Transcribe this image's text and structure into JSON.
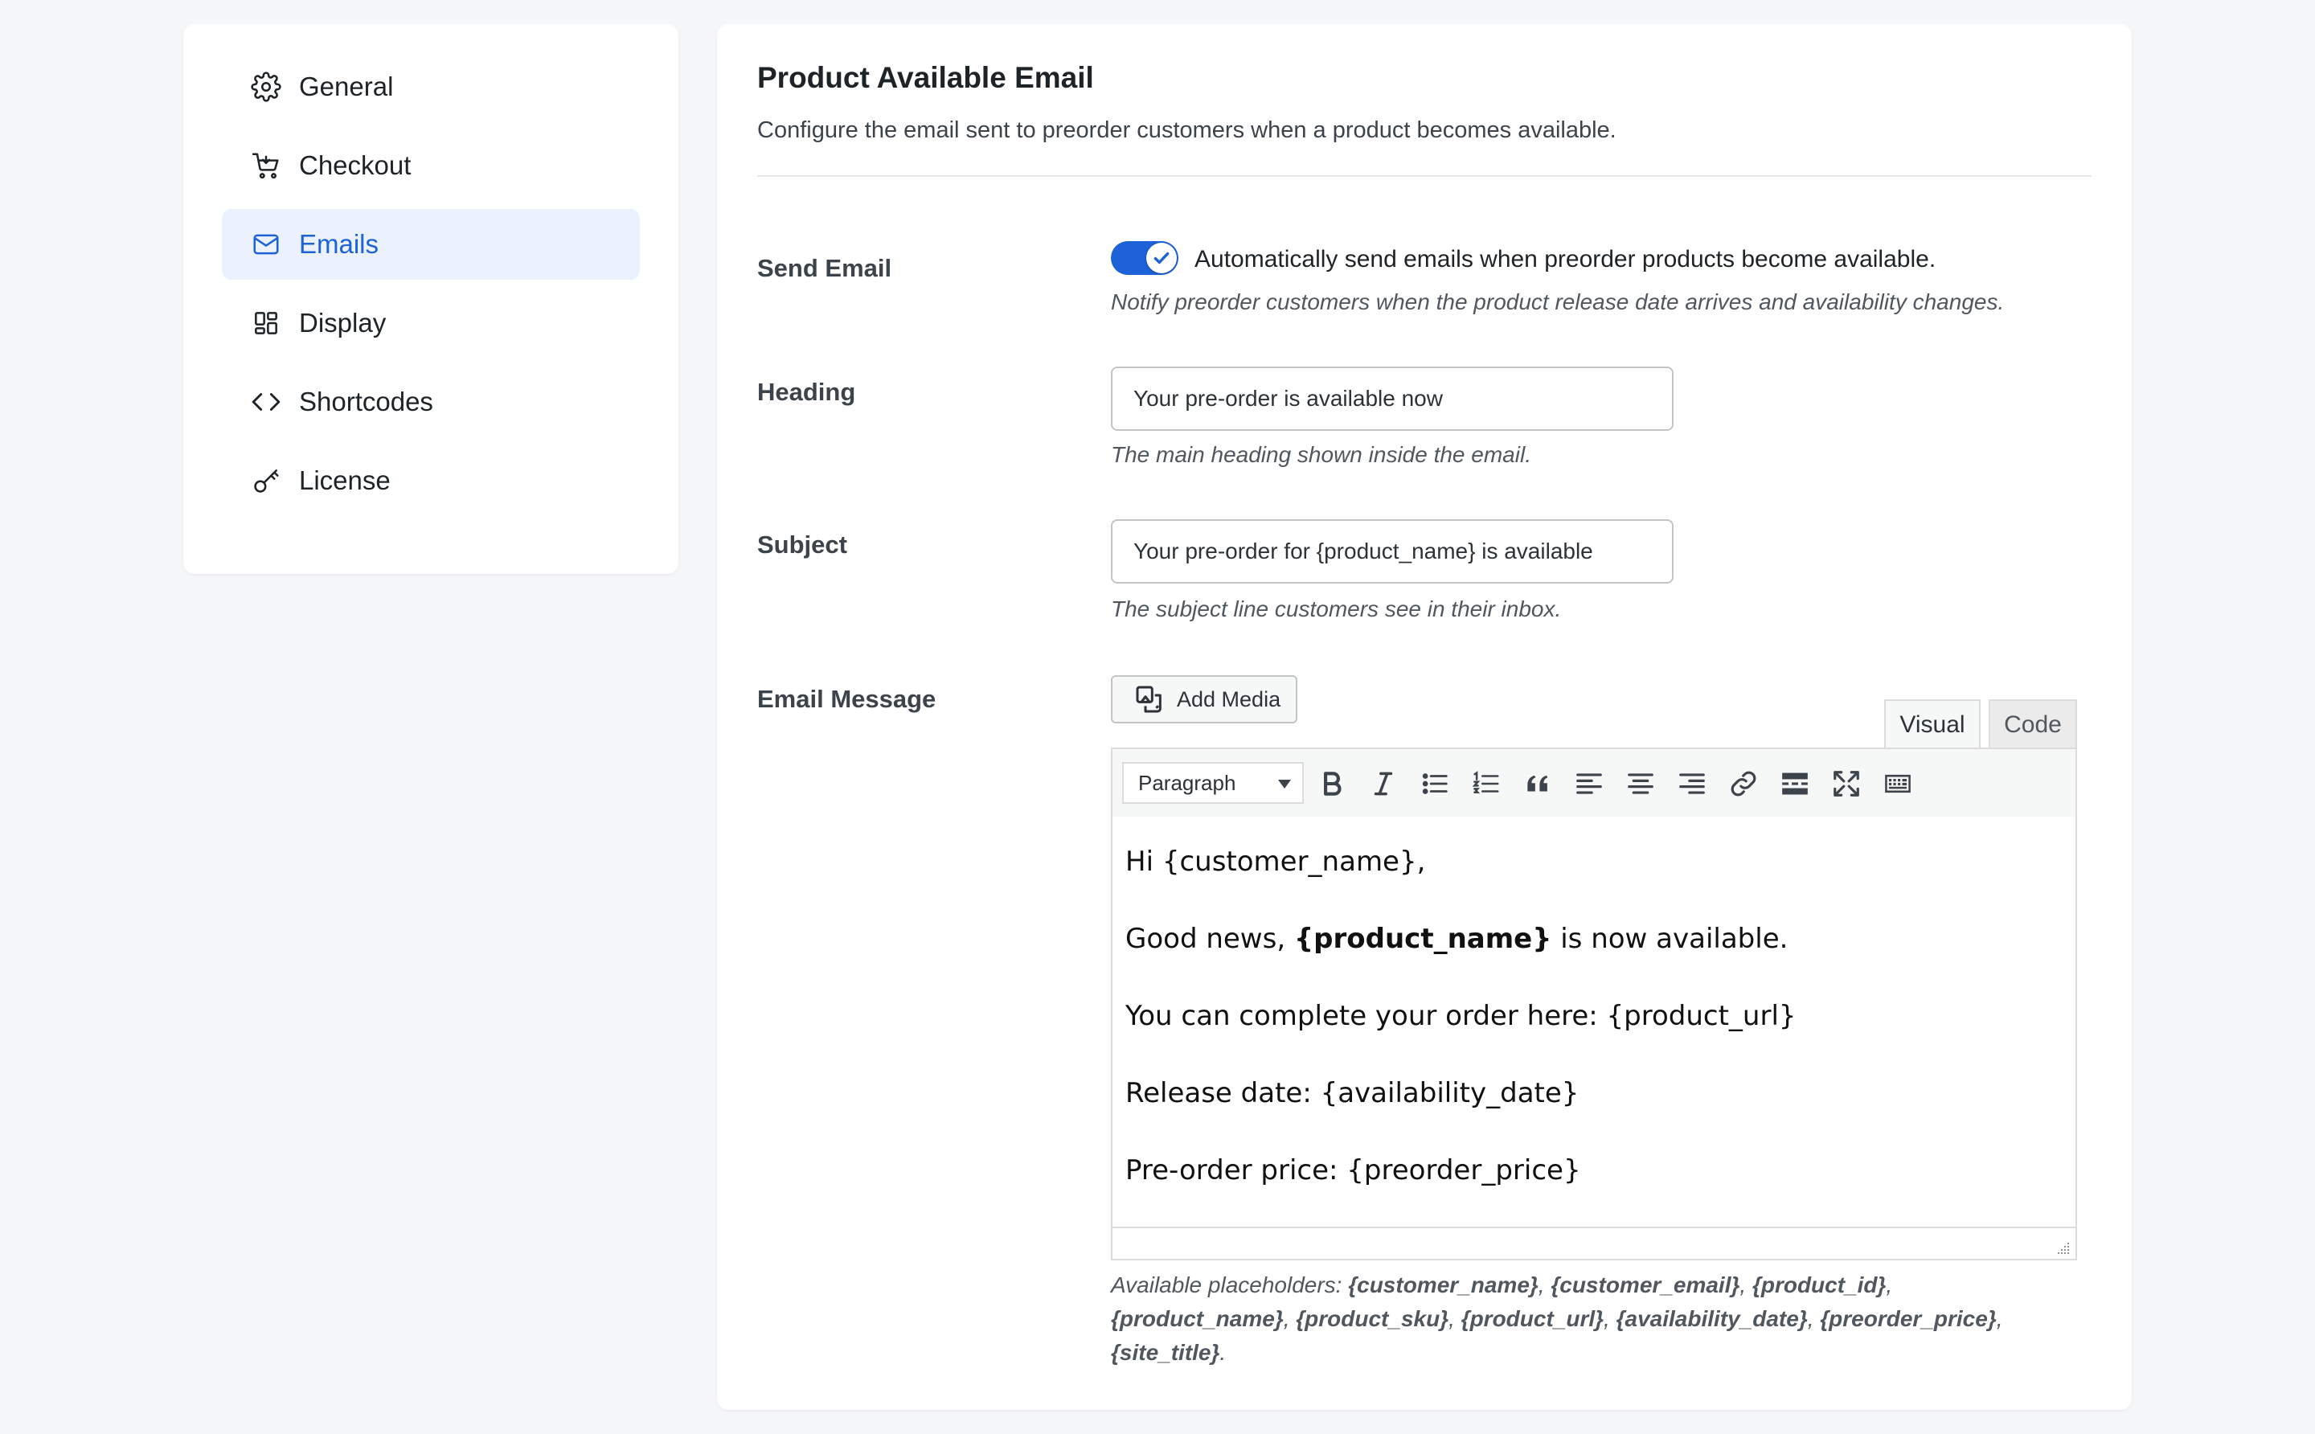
{
  "sidebar": {
    "items": [
      {
        "label": "General",
        "icon": "gear-icon"
      },
      {
        "label": "Checkout",
        "icon": "cart-icon"
      },
      {
        "label": "Emails",
        "icon": "mail-icon",
        "active": true
      },
      {
        "label": "Display",
        "icon": "layout-icon"
      },
      {
        "label": "Shortcodes",
        "icon": "code-icon"
      },
      {
        "label": "License",
        "icon": "key-icon"
      }
    ]
  },
  "main": {
    "title": "Product Available Email",
    "description": "Configure the email sent to preorder customers when a product becomes available.",
    "send_email": {
      "label": "Send Email",
      "enabled": true,
      "toggle_text": "Automatically send emails when preorder products become available.",
      "help": "Notify preorder customers when the product release date arrives and availability changes."
    },
    "heading": {
      "label": "Heading",
      "value": "Your pre-order is available now",
      "help": "The main heading shown inside the email."
    },
    "subject": {
      "label": "Subject",
      "value": "Your pre-order for {product_name} is available",
      "help": "The subject line customers see in their inbox."
    },
    "message": {
      "label": "Email Message",
      "add_media": "Add Media",
      "tabs": {
        "visual": "Visual",
        "code": "Code"
      },
      "format": "Paragraph",
      "lines": {
        "greeting": "Hi {customer_name},",
        "news_prefix": "Good news, ",
        "news_bold": "{product_name}",
        "news_suffix": " is now available.",
        "complete": "You can complete your order here: {product_url}",
        "release": "Release date: {availability_date}",
        "price": "Pre-order price: {preorder_price}"
      },
      "placeholders_label": "Available placeholders: ",
      "placeholders": [
        "{customer_name}",
        "{customer_email}",
        "{product_id}",
        "{product_name}",
        "{product_sku}",
        "{product_url}",
        "{availability_date}",
        "{preorder_price}",
        "{site_title}"
      ],
      "placeholder_sep": ", ",
      "placeholder_end": "."
    }
  },
  "colors": {
    "accent": "#1d62d8",
    "active_bg": "#ebf2fd"
  }
}
